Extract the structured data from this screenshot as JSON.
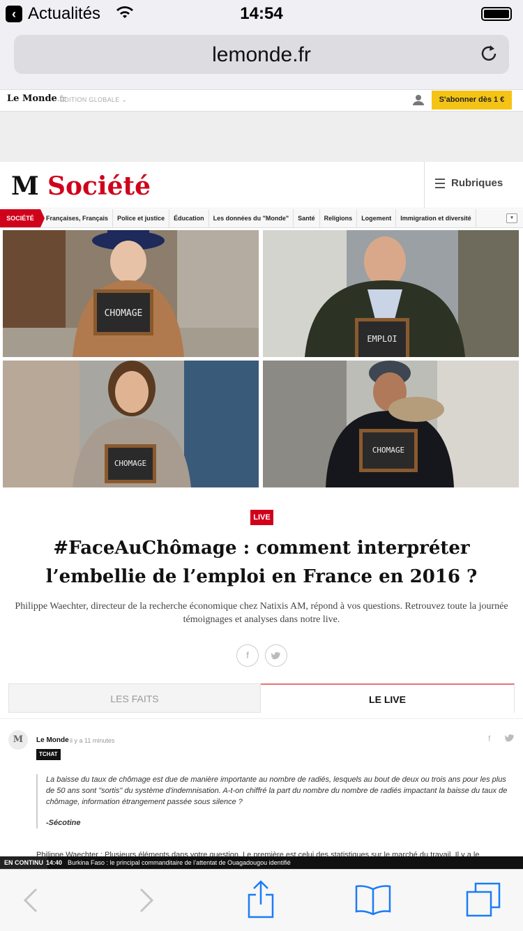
{
  "status_bar": {
    "back_label": "Actualités",
    "time": "14:54"
  },
  "browser": {
    "url": "lemonde.fr"
  },
  "site_bar": {
    "logo": "Le Monde",
    "logo_suffix": ".fr",
    "edition": "ÉDITION GLOBALE",
    "subscribe": "S'abonner dès 1 €"
  },
  "section": {
    "logo": "M",
    "title": "Société",
    "menu_label": "Rubriques"
  },
  "subnav": {
    "active": "SOCIÉTÉ",
    "items": [
      "Françaises, Français",
      "Police et justice",
      "Éducation",
      "Les données du \"Monde\"",
      "Santé",
      "Religions",
      "Logement",
      "Immigration et diversité"
    ]
  },
  "photos": [
    {
      "board": "CHOMAGE"
    },
    {
      "board": "EMPLOI"
    },
    {
      "board": "CHOMAGE"
    },
    {
      "board": "CHOMAGE"
    }
  ],
  "article": {
    "badge": "LIVE",
    "headline": "#FaceAuChômage : comment interpréter l’embellie de l’emploi en France en 2016 ?",
    "intro": "Philippe Waechter, directeur de la recherche économique chez Natixis AM, répond à vos questions. Retrouvez toute la journée témoignages et analyses dans notre live."
  },
  "tabs": {
    "facts": "LES FAITS",
    "live": "LE LIVE"
  },
  "post": {
    "author": "Le Monde",
    "time": "il y a 11 minutes",
    "tag": "TCHAT",
    "quote": "La baisse du taux de chômage est due de manière importante au nombre de radiés, lesquels au bout de deux ou trois ans pour les plus de 50 ans sont \"sortis\" du système d'indemnisation. A-t-on chiffré la part du nombre du nombre de radiés impactant la baisse du taux de chômage, information étrangement passée sous silence ?",
    "signature": "-Sécotine",
    "cut_text": "Philippe Waechter : Plusieurs éléments dans votre question. Le première est celui des statistiques sur le marché du travail. Il y a le"
  },
  "ticker": {
    "label": "EN CONTINU",
    "time": "14:40",
    "text": "Burkina Faso : le principal commanditaire de l’attentat de Ouagadougou identifié"
  }
}
